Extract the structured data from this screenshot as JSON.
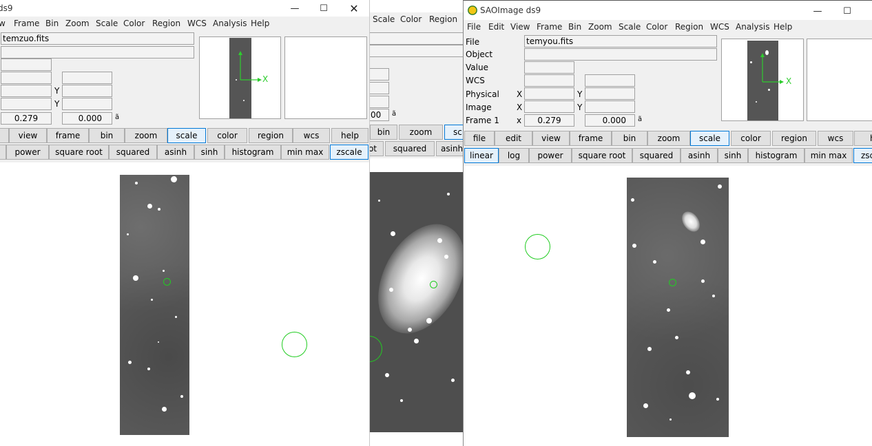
{
  "left_window": {
    "title": "ds9",
    "menu": [
      "w",
      "Frame",
      "Bin",
      "Zoom",
      "Scale",
      "Color",
      "Region",
      "WCS",
      "Analysis",
      "Help"
    ],
    "file_value": "temzuo.fits",
    "y_label_1": "Y",
    "y_label_2": "Y",
    "frame_value_1": "0.279",
    "frame_value_2": "0.000",
    "frame_suffix": "ã",
    "buttons_row1": [
      "view",
      "frame",
      "bin",
      "zoom",
      "scale",
      "color",
      "region",
      "wcs",
      "help"
    ],
    "buttons_row2": [
      "power",
      "square root",
      "squared",
      "asinh",
      "sinh",
      "histogram",
      "min max",
      "zscale"
    ],
    "thumb_axis_label": "X"
  },
  "middle_window": {
    "menu": [
      "Scale",
      "Color",
      "Region"
    ],
    "value_partial": "00",
    "frame_suffix": "ã",
    "buttons_row1": [
      "bin",
      "zoom",
      "sc"
    ],
    "buttons_row2": [
      "ot",
      "squared",
      "asinh"
    ]
  },
  "right_window": {
    "title": "SAOImage ds9",
    "menu": [
      "File",
      "Edit",
      "View",
      "Frame",
      "Bin",
      "Zoom",
      "Scale",
      "Color",
      "Region",
      "WCS",
      "Analysis",
      "Help"
    ],
    "labels": {
      "file": "File",
      "object": "Object",
      "value": "Value",
      "wcs": "WCS",
      "physical": "Physical",
      "image": "Image",
      "frame": "Frame 1",
      "x_physical": "X",
      "x_image": "X",
      "x_frame": "x",
      "y_physical": "Y",
      "y_image": "Y"
    },
    "file_value": "temyou.fits",
    "frame_value_1": "0.279",
    "frame_value_2": "0.000",
    "frame_suffix": "ã",
    "buttons_row1": [
      "file",
      "edit",
      "view",
      "frame",
      "bin",
      "zoom",
      "scale",
      "color",
      "region",
      "wcs",
      "he"
    ],
    "buttons_row2": [
      "linear",
      "log",
      "power",
      "square root",
      "squared",
      "asinh",
      "sinh",
      "histogram",
      "min max",
      "zsc"
    ],
    "thumb_axis_label": "X"
  },
  "colors": {
    "panel_bg": "#f0f0f0",
    "button_bg": "#e1e1e1",
    "selected_border": "#0078d7",
    "region_green": "#22cc22"
  }
}
